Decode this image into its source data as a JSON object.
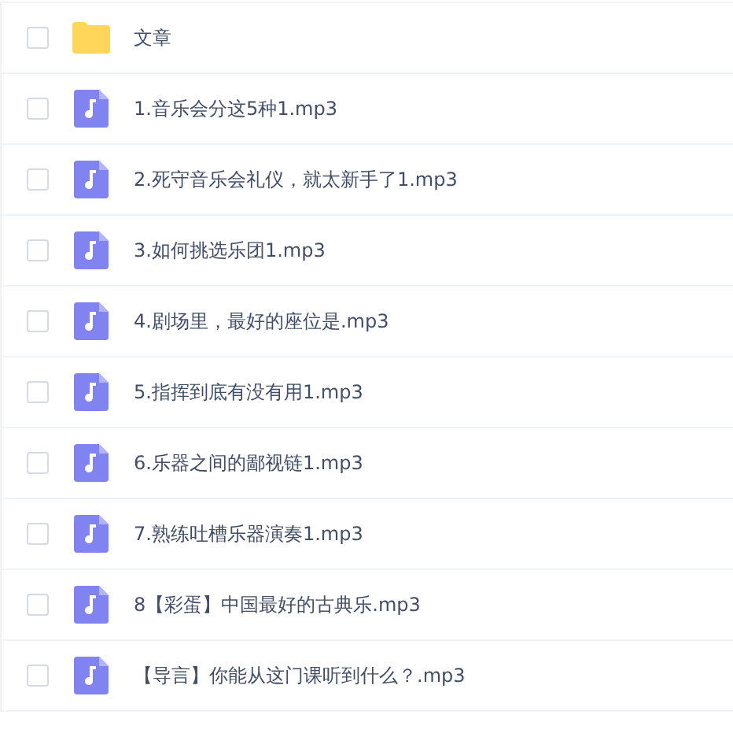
{
  "files": [
    {
      "kind": "folder",
      "name": "文章",
      "checked": false
    },
    {
      "kind": "audio",
      "name": "1.音乐会分这5种1.mp3",
      "checked": false
    },
    {
      "kind": "audio",
      "name": "2.死守音乐会礼仪，就太新手了1.mp3",
      "checked": false
    },
    {
      "kind": "audio",
      "name": "3.如何挑选乐团1.mp3",
      "checked": false
    },
    {
      "kind": "audio",
      "name": "4.剧场里，最好的座位是.mp3",
      "checked": false
    },
    {
      "kind": "audio",
      "name": "5.指挥到底有没有用1.mp3",
      "checked": false
    },
    {
      "kind": "audio",
      "name": "6.乐器之间的鄙视链1.mp3",
      "checked": false
    },
    {
      "kind": "audio",
      "name": "7.熟练吐槽乐器演奏1.mp3",
      "checked": false
    },
    {
      "kind": "audio",
      "name": "8【彩蛋】中国最好的古典乐.mp3",
      "checked": false
    },
    {
      "kind": "audio",
      "name": "【导言】你能从这门课听到什么？.mp3",
      "checked": false
    }
  ]
}
